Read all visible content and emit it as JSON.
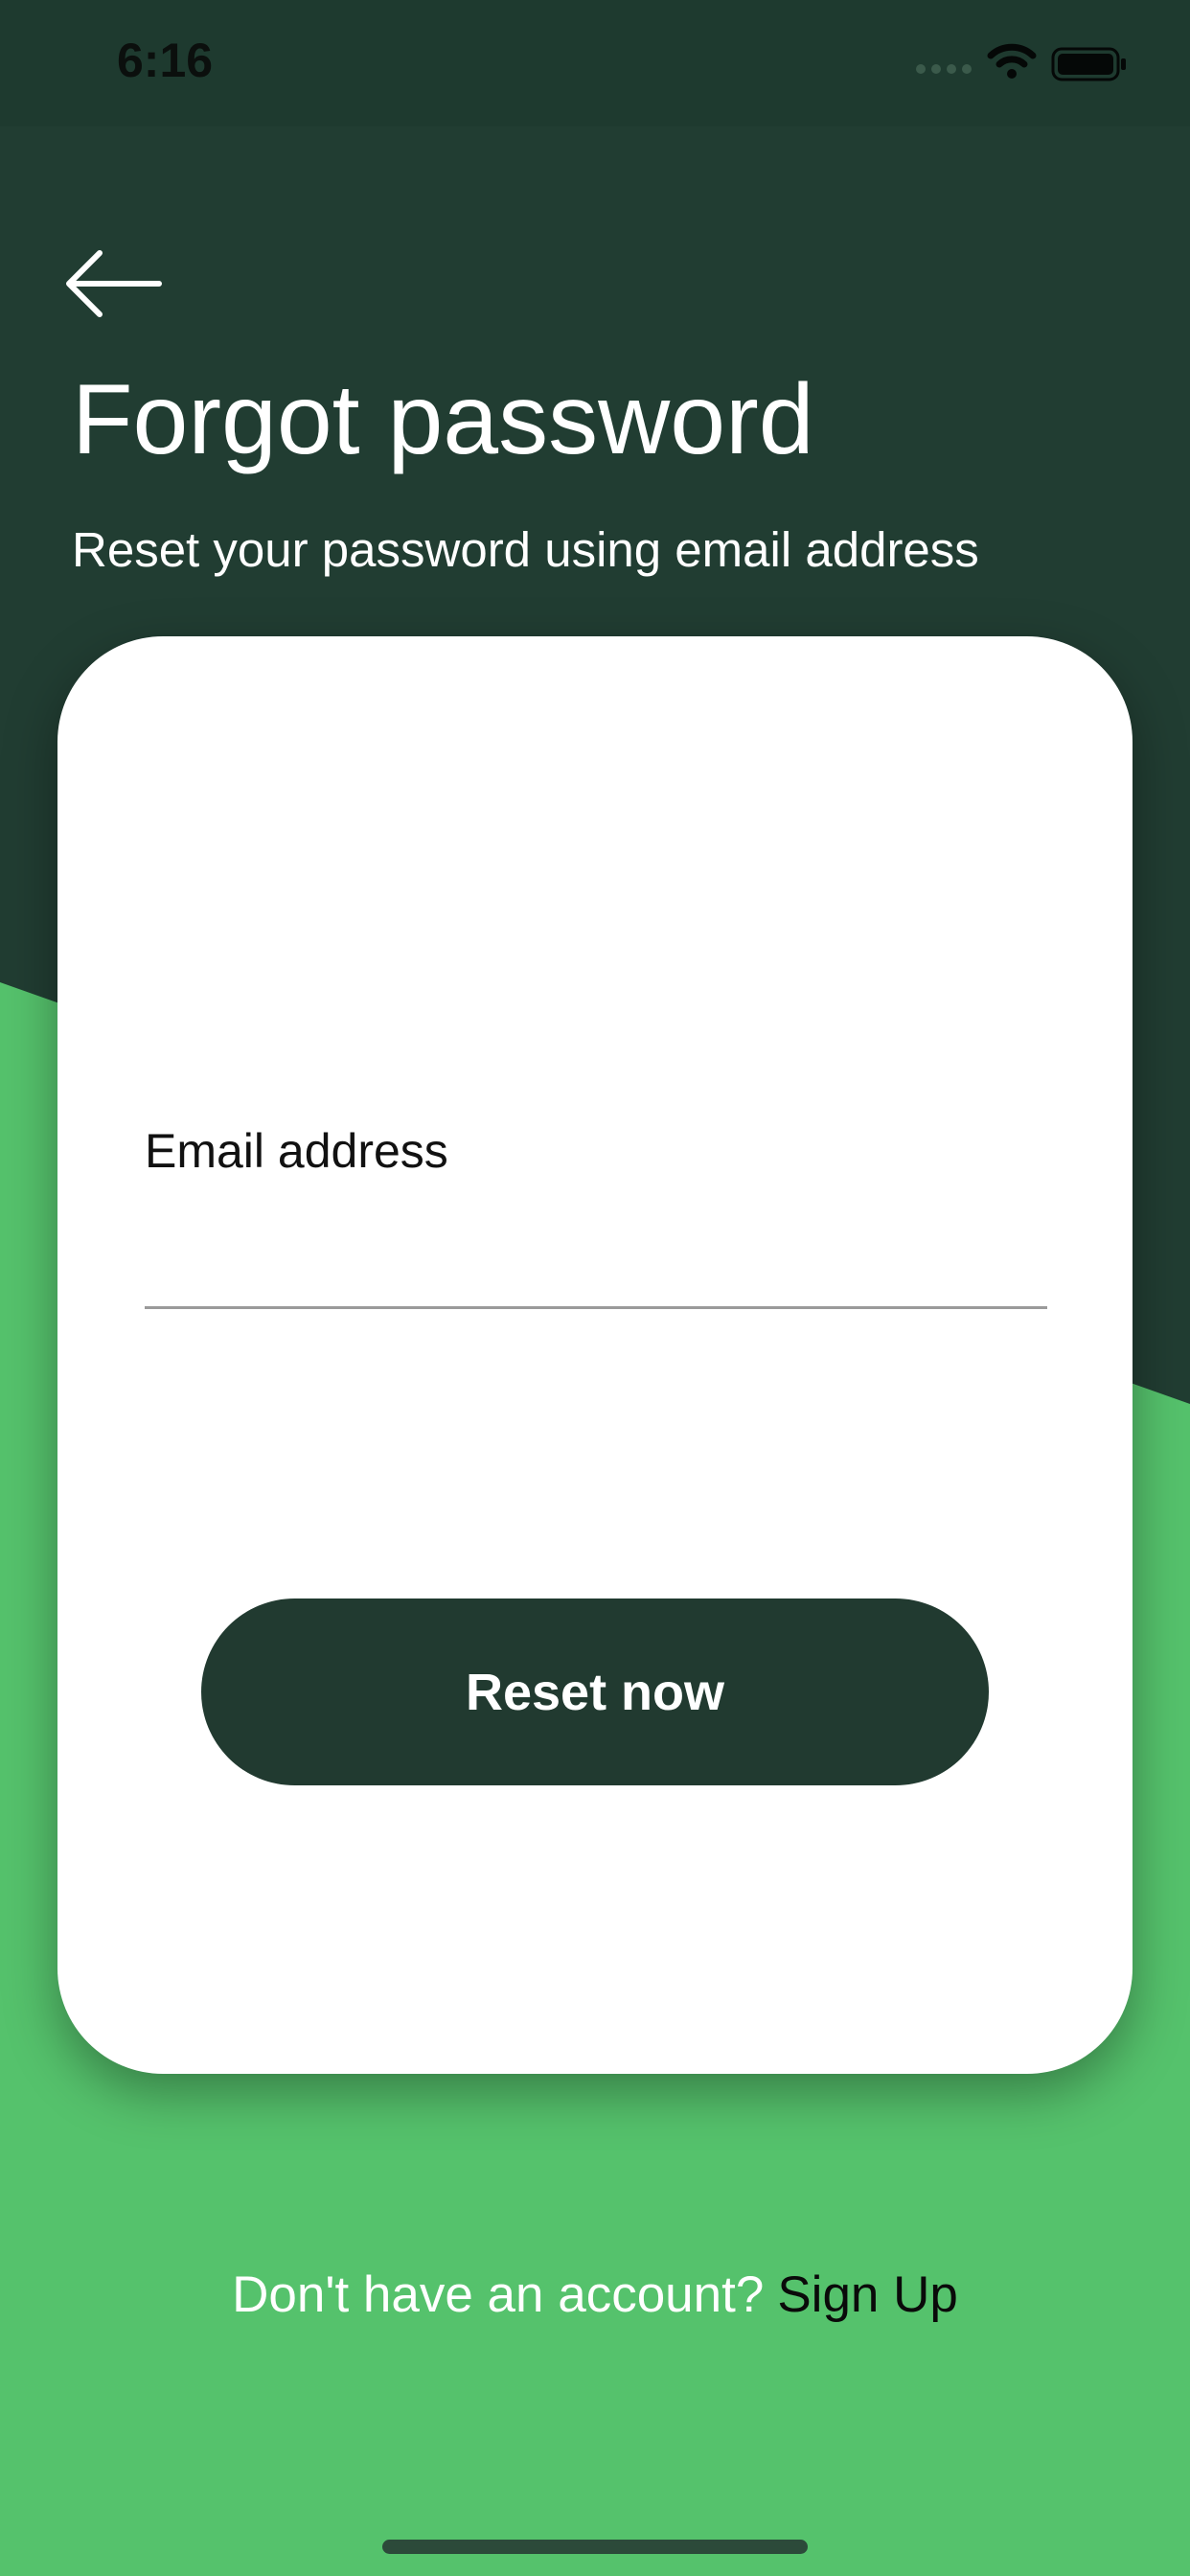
{
  "status_bar": {
    "time": "6:16",
    "signal_icon": "cellular-dots-icon",
    "wifi_icon": "wifi-icon",
    "battery_icon": "battery-icon"
  },
  "header": {
    "back_icon": "arrow-left-icon",
    "title": "Forgot password",
    "subtitle": "Reset your password using email address"
  },
  "form": {
    "email_label": "Email address",
    "email_value": "",
    "email_placeholder": "",
    "submit_label": "Reset now"
  },
  "footer": {
    "prompt": "Don't have an account?",
    "link_label": "Sign Up"
  },
  "colors": {
    "dark_green": "#213d32",
    "accent_green": "#55c26c",
    "card": "#ffffff",
    "button": "#213a30"
  }
}
